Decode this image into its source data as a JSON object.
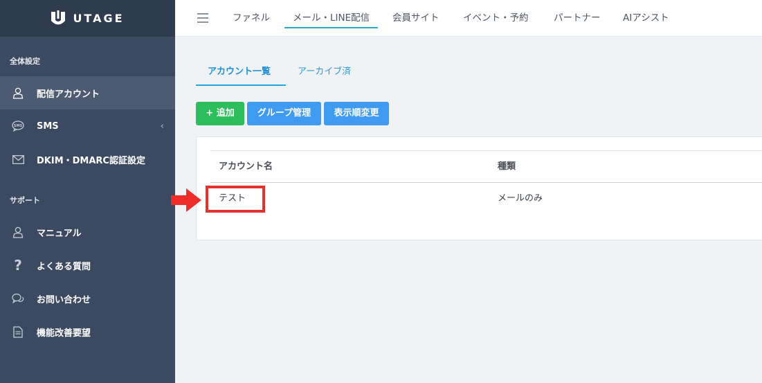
{
  "app": {
    "logo_text": "UTAGE"
  },
  "sidebar": {
    "sections": [
      {
        "label": "全体設定"
      },
      {
        "label": "サポート"
      }
    ],
    "items": [
      {
        "label": "配信アカウント",
        "icon": "user-icon",
        "active": true
      },
      {
        "label": "SMS",
        "icon": "sms-icon",
        "has_submenu": true,
        "chevron": "‹"
      },
      {
        "label": "DKIM・DMARC認証設定",
        "icon": "mail-icon"
      },
      {
        "label": "マニュアル",
        "icon": "user-icon"
      },
      {
        "label": "よくある質問",
        "icon": "question-icon"
      },
      {
        "label": "お問い合わせ",
        "icon": "chat-icon"
      },
      {
        "label": "機能改善要望",
        "icon": "document-icon"
      }
    ]
  },
  "topnav": {
    "items": [
      {
        "label": "ファネル"
      },
      {
        "label": "メール・LINE配信",
        "active": true
      },
      {
        "label": "会員サイト"
      },
      {
        "label": "イベント・予約"
      },
      {
        "label": "パートナー"
      },
      {
        "label": "AIアシスト"
      }
    ]
  },
  "tabs": [
    {
      "label": "アカウント一覧",
      "active": true
    },
    {
      "label": "アーカイブ済"
    }
  ],
  "toolbar": {
    "add_label": "+ 追加",
    "group_label": "グループ管理",
    "order_label": "表示順変更"
  },
  "table": {
    "columns": [
      "アカウント名",
      "種類"
    ],
    "rows": [
      {
        "name": "テスト",
        "type": "メールのみ"
      }
    ]
  },
  "colors": {
    "sidebar_bg": "#3b4a60",
    "accent": "#20a8d8",
    "add_button": "#2dbd5c",
    "blue_button": "#3e9bef",
    "annotation": "#e4322e"
  }
}
